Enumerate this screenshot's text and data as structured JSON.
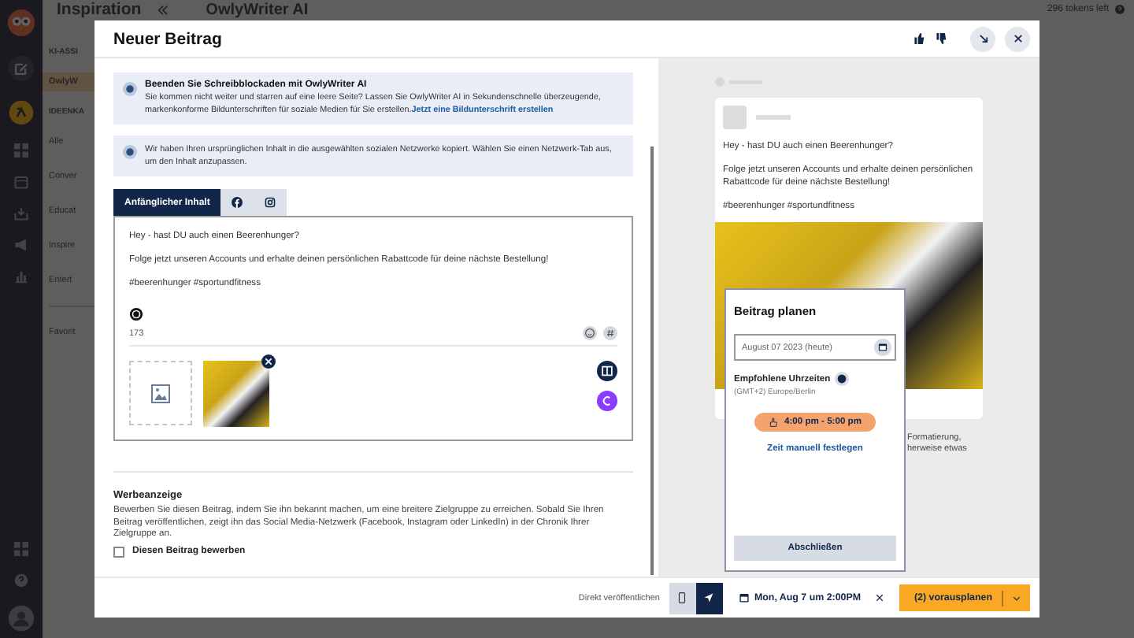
{
  "app": {
    "page_title": "Inspiration",
    "tool_title": "OwlyWriter AI",
    "tokens": "296 tokens left",
    "sidebar": [
      {
        "kind": "heading",
        "label": "KI-ASSI"
      },
      {
        "kind": "item",
        "label": "OwlyW",
        "selected": true
      },
      {
        "kind": "heading",
        "label": "IDEENKA"
      },
      {
        "kind": "item",
        "label": "Alle",
        "selected": false
      },
      {
        "kind": "item",
        "label": "Conver",
        "selected": false
      },
      {
        "kind": "item",
        "label": "Educat",
        "selected": false
      },
      {
        "kind": "item",
        "label": "Inspire",
        "selected": false
      },
      {
        "kind": "item",
        "label": "Entert",
        "selected": false
      },
      {
        "kind": "divider"
      },
      {
        "kind": "item",
        "label": "Favorit",
        "selected": false
      }
    ]
  },
  "modal": {
    "title": "Neuer Beitrag"
  },
  "banners": [
    {
      "title": "Beenden Sie Schreibblockaden mit OwlyWriter AI",
      "text": "Sie kommen nicht weiter und starren auf eine leere Seite? Lassen Sie OwlyWriter AI in Sekundenschnelle überzeugende, markenkonforme Bildunterschriften für soziale Medien für Sie erstellen.",
      "link": "Jetzt eine Bildunterschrift erstellen"
    },
    {
      "text": "Wir haben Ihren ursprünglichen Inhalt in die ausgewählten sozialen Netzwerke kopiert. Wählen Sie einen Netzwerk-Tab aus, um den Inhalt anzupassen."
    }
  ],
  "tabs": [
    {
      "kind": "text",
      "label": "Anfänglicher Inhalt",
      "selected": true
    },
    {
      "kind": "facebook",
      "selected": false
    },
    {
      "kind": "instagram",
      "selected": false
    }
  ],
  "editor": {
    "paragraphs": [
      "Hey - hast DU auch einen Beerenhunger?",
      "Folge jetzt unseren Accounts und erhalte deinen persönlichen Rabattcode für deine nächste Bestellung!",
      "#beerenhunger #sportundfitness"
    ],
    "char_count": "173"
  },
  "promotion": {
    "title": "Werbeanzeige",
    "text": "Bewerben Sie diesen Beitrag, indem Sie ihn bekannt machen, um eine breitere Zielgruppe zu erreichen. Sobald Sie Ihren Beitrag veröffentlichen, zeigt ihn das Social Media-Netzwerk (Facebook, Instagram oder LinkedIn) in der Chronik Ihrer Zielgruppe an.",
    "checkbox": {
      "label": "Diesen Beitrag bewerben",
      "checked": false
    }
  },
  "preview": {
    "paragraphs": [
      "Hey - hast DU auch einen Beerenhunger?",
      "Folge jetzt unseren Accounts und erhalte deinen persönlichen Rabattcode für deine nächste Bestellung!",
      "#beerenhunger #sportundfitness"
    ],
    "note_lines": [
      "Formatierung,",
      "herweise etwas"
    ]
  },
  "schedule_popover": {
    "title": "Beitrag planen",
    "date": "August 07 2023 (heute)",
    "recommended_label": "Empfohlene Uhrzeiten",
    "timezone": "(GMT+2) Europe/Berlin",
    "time_slots": [
      {
        "label": "4:00 pm - 5:00 pm",
        "selected": true
      }
    ],
    "manual_link": "Zeit manuell festlegen",
    "done_button": "Abschließen"
  },
  "footer": {
    "publish_label": "Direkt veröffentlichen",
    "modes": [
      {
        "kind": "mobile",
        "selected": false
      },
      {
        "kind": "send",
        "selected": true
      }
    ],
    "scheduled_time": "Mon, Aug 7 um 2:00PM",
    "schedule_button": "(2) vorausplanen"
  }
}
